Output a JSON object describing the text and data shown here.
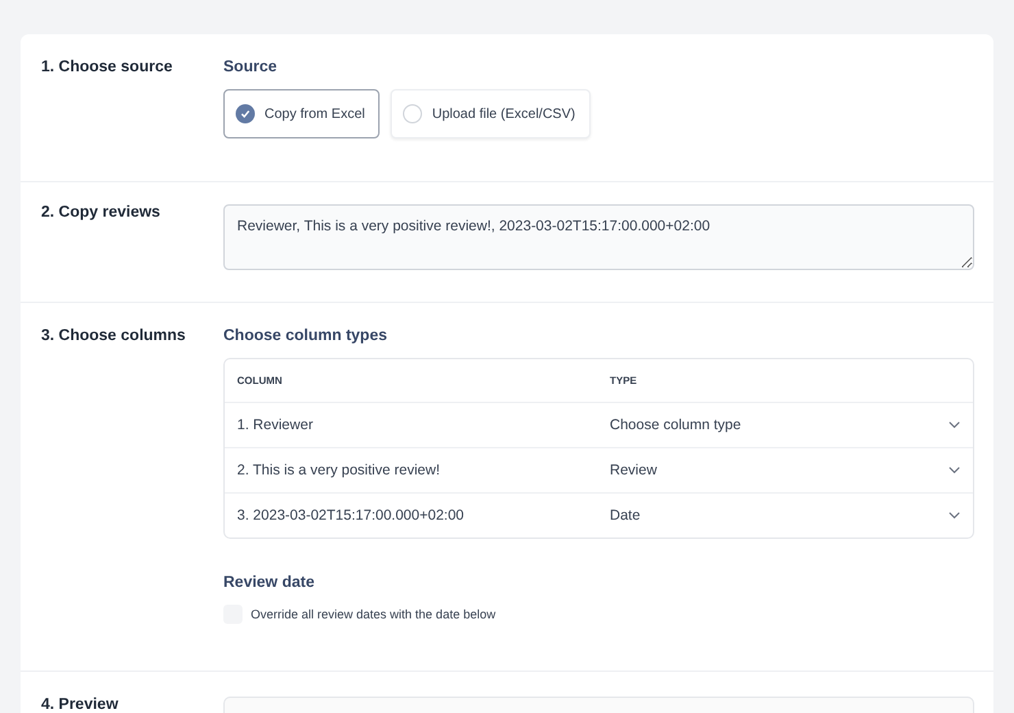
{
  "sections": [
    {
      "kind": "source",
      "title": "1. Choose source",
      "heading": "Source",
      "options": [
        {
          "label": "Copy from Excel",
          "selected": true
        },
        {
          "label": "Upload file (Excel/CSV)",
          "selected": false
        }
      ]
    },
    {
      "kind": "paste",
      "title": "2. Copy reviews",
      "value": "Reviewer, This is a very positive review!, 2023-03-02T15:17:00.000+02:00"
    },
    {
      "kind": "columns",
      "title": "3. Choose columns",
      "heading": "Choose column types",
      "columns": [
        "COLUMN",
        "TYPE"
      ],
      "rows": [
        {
          "column": "1. Reviewer",
          "type": "Choose column type"
        },
        {
          "column": "2. This is a very positive review!",
          "type": "Review"
        },
        {
          "column": "3. 2023-03-02T15:17:00.000+02:00",
          "type": "Date"
        }
      ],
      "date_heading": "Review date",
      "override": {
        "label": "Override all review dates with the date below",
        "checked": false
      }
    },
    {
      "kind": "preview",
      "title": "4. Preview"
    }
  ]
}
